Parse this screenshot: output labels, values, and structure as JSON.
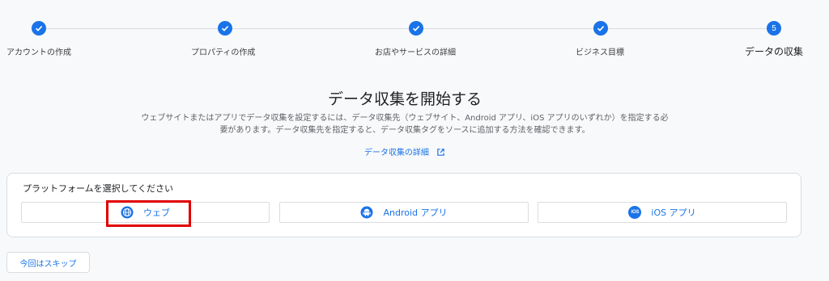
{
  "stepper": {
    "steps": [
      {
        "label": "アカウントの作成",
        "state": "done",
        "icon": "check-icon"
      },
      {
        "label": "プロパティの作成",
        "state": "done",
        "icon": "check-icon"
      },
      {
        "label": "お店やサービスの詳細",
        "state": "done",
        "icon": "check-icon"
      },
      {
        "label": "ビジネス目標",
        "state": "done",
        "icon": "check-icon"
      },
      {
        "label": "データの収集",
        "state": "active",
        "number": "5"
      }
    ]
  },
  "main": {
    "title": "データ収集を開始する",
    "description": "ウェブサイトまたはアプリでデータ収集を設定するには、データ収集先（ウェブサイト、Android アプリ、iOS アプリのいずれか）を指定する必要があります。データ収集先を指定すると、データ収集タグをソースに追加する方法を確認できます。",
    "learn_more": "データ収集の詳細"
  },
  "platform": {
    "heading": "プラットフォームを選択してください",
    "buttons": [
      {
        "label": "ウェブ",
        "icon": "globe-icon"
      },
      {
        "label": "Android アプリ",
        "icon": "android-icon"
      },
      {
        "label": "iOS アプリ",
        "icon": "ios-icon",
        "badge": "iOS"
      }
    ]
  },
  "footer": {
    "skip": "今回はスキップ"
  },
  "colors": {
    "accent": "#1a73e8",
    "highlight": "#e00000"
  }
}
